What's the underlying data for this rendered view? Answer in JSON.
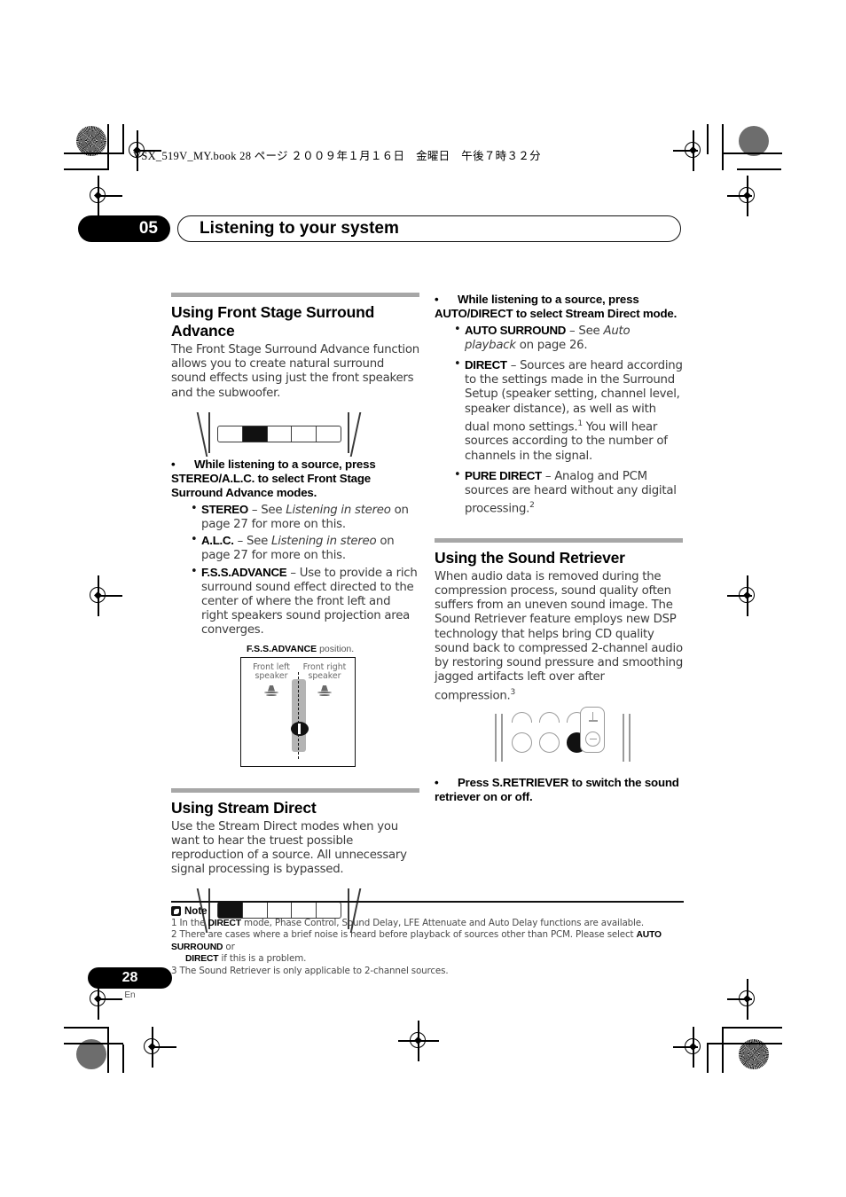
{
  "print_marks": {
    "book_line": "VSX_519V_MY.book   28 ページ   ２００９年１月１６日　金曜日　午後７時３２分"
  },
  "header": {
    "chapter_number": "05",
    "chapter_title": "Listening to your system"
  },
  "left_column": {
    "section1": {
      "heading": "Using Front Stage Surround Advance",
      "intro": "The Front Stage Surround Advance function allows you to create natural surround sound effects using just the front speakers and the subwoofer.",
      "panel_diagram": {
        "name": "front-panel-display",
        "segments": 5,
        "lit_index": 1
      },
      "instruction": "While listening to a source, press STEREO/A.L.C. to select Front Stage Surround Advance modes.",
      "modes": [
        {
          "term": "STEREO",
          "dash": "–",
          "text_pre": " See ",
          "italic": "Listening in stereo",
          "text_post": " on page 27 for more on this."
        },
        {
          "term": "A.L.C.",
          "dash": "–",
          "text_pre": " See ",
          "italic": "Listening in stereo",
          "text_post": " on page 27 for more on this."
        },
        {
          "term": "F.S.S.ADVANCE",
          "dash": "–",
          "text_pre": " Use to provide a rich surround sound effect directed to the center of where the front left and right speakers sound projection area converges.",
          "italic": "",
          "text_post": ""
        }
      ],
      "figure": {
        "caption_bold": "F.S.S.ADVANCE",
        "caption_rest": " position.",
        "label_left": "Front left speaker",
        "label_right": "Front right speaker"
      }
    },
    "section2": {
      "heading": "Using Stream Direct",
      "intro": "Use the Stream Direct modes when you want to hear the truest possible reproduction of a source. All unnecessary signal processing is bypassed.",
      "panel_diagram": {
        "name": "front-panel-display",
        "segments": 5,
        "lit_index": 0
      }
    }
  },
  "right_column": {
    "instruction": "While listening to a source, press AUTO/DIRECT to select Stream Direct mode.",
    "modes": [
      {
        "term": "AUTO SURROUND",
        "dash": "–",
        "text_pre": " See ",
        "italic": "Auto playback",
        "text_post": " on page 26.",
        "sup": ""
      },
      {
        "term": "DIRECT",
        "dash": "–",
        "text_pre": " Sources are heard according to the settings made in the Surround Setup (speaker setting, channel level, speaker distance), as well as with dual mono settings.",
        "italic": "",
        "text_post": " You will hear sources according to the number of channels in the signal.",
        "sup": "1"
      },
      {
        "term": "PURE DIRECT",
        "dash": "–",
        "text_pre": " Analog and PCM sources are heard without any digital processing.",
        "italic": "",
        "text_post": "",
        "sup": "2"
      }
    ],
    "section": {
      "heading": "Using the Sound Retriever",
      "body_pre": "When audio data is removed during the compression process, sound quality often suffers from an uneven sound image. The Sound Retriever feature employs new DSP technology that helps bring CD quality sound back to compressed 2-channel audio by restoring sound pressure and smoothing jagged artifacts left over after compression.",
      "body_sup": "3",
      "instruction": "Press S.RETRIEVER to switch the sound retriever on or off."
    }
  },
  "notes": {
    "title": "Note",
    "items": [
      {
        "num": "1",
        "pre": "In the ",
        "bold": "DIRECT",
        "post": " mode, Phase Control, Sound Delay, LFE Attenuate and Auto Delay functions are available.",
        "indent": false
      },
      {
        "num": "2",
        "pre": "There are cases where a brief noise is heard before playback of sources other than PCM. Please select ",
        "bold": "AUTO SURROUND",
        "post": " or",
        "indent": false
      },
      {
        "num": "",
        "pre": "",
        "bold": "DIRECT",
        "post": " if this is a problem.",
        "indent": true
      },
      {
        "num": "3",
        "pre": "The Sound Retriever is only applicable to 2-channel sources.",
        "bold": "",
        "post": "",
        "indent": false
      }
    ]
  },
  "footer": {
    "page_number": "28",
    "language": "En"
  },
  "colors": {
    "accent_black": "#000000",
    "rule_gray": "#a7a7a7",
    "body_gray": "#3b3b3b"
  }
}
